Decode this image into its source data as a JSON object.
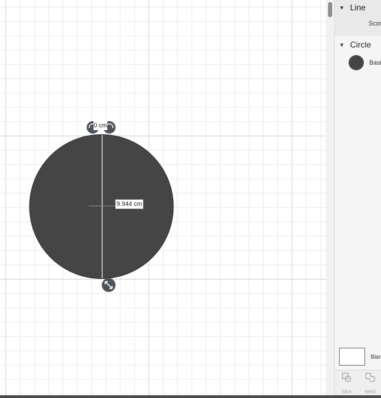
{
  "colors": {
    "shape_fill": "#454545",
    "handle": "#4d5359",
    "grid_minor": "#ececec",
    "grid_major": "#d6d6d6",
    "panel_bg": "#f5f5f5"
  },
  "canvas": {
    "width_label": "0 cm",
    "diameter_label": "9.944 cm",
    "handles": {
      "rotate_left_icon": "rotate-left-icon",
      "rotate_right_icon": "rotate-right-icon",
      "resize_icon": "resize-diagonal-icon"
    }
  },
  "layers_panel": {
    "groups": [
      {
        "title": "Line",
        "item_label": "Scor",
        "caret": "▼"
      },
      {
        "title": "Circle",
        "item_label": "Basi",
        "caret": "▼",
        "swatch_color": "#454545"
      }
    ],
    "blank": {
      "label": "Blan"
    }
  },
  "toolbar": {
    "slice_label": "Slice",
    "slice_icon": "slice-icon",
    "weld_label": "Weld",
    "weld_icon": "weld-icon"
  }
}
